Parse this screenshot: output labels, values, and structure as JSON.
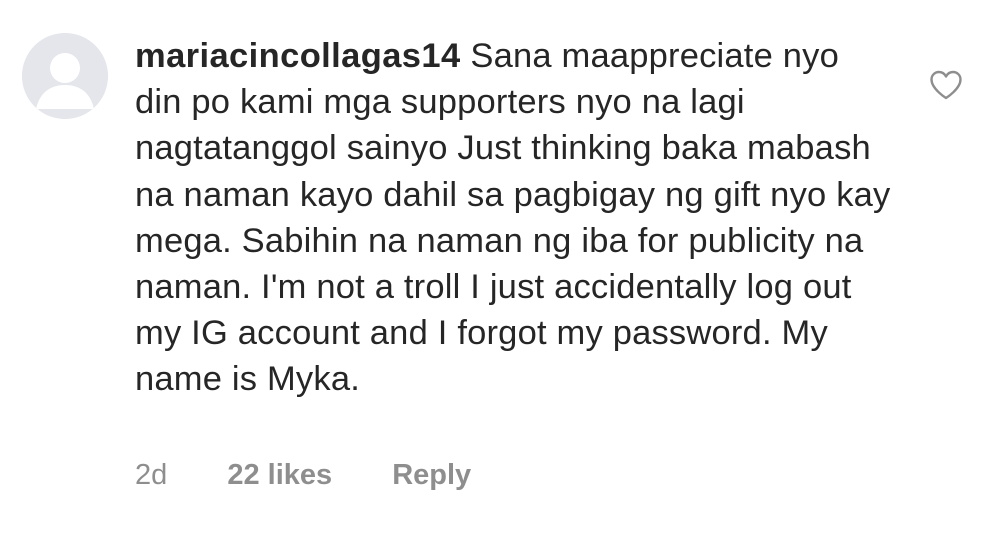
{
  "comment": {
    "username": "mariacincollagas14",
    "text": "Sana maappreciate nyo din po kami mga supporters nyo na lagi nagtatanggol sainyo Just thinking baka mabash na naman kayo dahil sa pagbigay ng gift nyo kay mega. Sabihin na naman ng iba for publicity na naman. I'm not a troll I just accidentally log out my IG account and I forgot my password. My name is Myka.",
    "time": "2d",
    "likes": "22 likes",
    "reply_label": "Reply"
  },
  "icons": {
    "avatar": "default-avatar-icon",
    "like": "heart-outline-icon"
  },
  "colors": {
    "text": "#262626",
    "meta": "#8e8e8e",
    "avatar_bg": "#e4e6eb",
    "avatar_fg": "#ffffff"
  }
}
